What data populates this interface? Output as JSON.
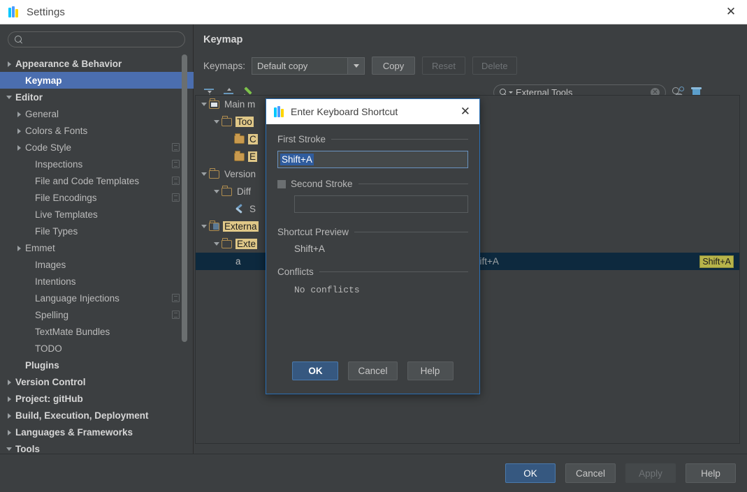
{
  "window": {
    "title": "Settings",
    "logo_icon": "webstorm-logo",
    "close_icon": "close-icon"
  },
  "sidebar": {
    "search_placeholder": "",
    "search_value": "",
    "search_icon": "search-icon",
    "items": [
      {
        "label": "Appearance & Behavior",
        "indent": 0,
        "arrow": "right",
        "bold": true,
        "selected": false,
        "copy": false
      },
      {
        "label": "Keymap",
        "indent": 1,
        "arrow": "none",
        "bold": true,
        "selected": true,
        "copy": false
      },
      {
        "label": "Editor",
        "indent": 0,
        "arrow": "down",
        "bold": true,
        "selected": false,
        "copy": false
      },
      {
        "label": "General",
        "indent": 1,
        "arrow": "right",
        "bold": false,
        "selected": false,
        "copy": false
      },
      {
        "label": "Colors & Fonts",
        "indent": 1,
        "arrow": "right",
        "bold": false,
        "selected": false,
        "copy": false
      },
      {
        "label": "Code Style",
        "indent": 1,
        "arrow": "right",
        "bold": false,
        "selected": false,
        "copy": true
      },
      {
        "label": "Inspections",
        "indent": 2,
        "arrow": "none",
        "bold": false,
        "selected": false,
        "copy": true
      },
      {
        "label": "File and Code Templates",
        "indent": 2,
        "arrow": "none",
        "bold": false,
        "selected": false,
        "copy": true
      },
      {
        "label": "File Encodings",
        "indent": 2,
        "arrow": "none",
        "bold": false,
        "selected": false,
        "copy": true
      },
      {
        "label": "Live Templates",
        "indent": 2,
        "arrow": "none",
        "bold": false,
        "selected": false,
        "copy": false
      },
      {
        "label": "File Types",
        "indent": 2,
        "arrow": "none",
        "bold": false,
        "selected": false,
        "copy": false
      },
      {
        "label": "Emmet",
        "indent": 1,
        "arrow": "right",
        "bold": false,
        "selected": false,
        "copy": false
      },
      {
        "label": "Images",
        "indent": 2,
        "arrow": "none",
        "bold": false,
        "selected": false,
        "copy": false
      },
      {
        "label": "Intentions",
        "indent": 2,
        "arrow": "none",
        "bold": false,
        "selected": false,
        "copy": false
      },
      {
        "label": "Language Injections",
        "indent": 2,
        "arrow": "none",
        "bold": false,
        "selected": false,
        "copy": true
      },
      {
        "label": "Spelling",
        "indent": 2,
        "arrow": "none",
        "bold": false,
        "selected": false,
        "copy": true
      },
      {
        "label": "TextMate Bundles",
        "indent": 2,
        "arrow": "none",
        "bold": false,
        "selected": false,
        "copy": false
      },
      {
        "label": "TODO",
        "indent": 2,
        "arrow": "none",
        "bold": false,
        "selected": false,
        "copy": false
      },
      {
        "label": "Plugins",
        "indent": 1,
        "arrow": "none",
        "bold": true,
        "selected": false,
        "copy": false
      },
      {
        "label": "Version Control",
        "indent": 0,
        "arrow": "right",
        "bold": true,
        "selected": false,
        "copy": false
      },
      {
        "label": "Project: gitHub",
        "indent": 0,
        "arrow": "right",
        "bold": true,
        "selected": false,
        "copy": false
      },
      {
        "label": "Build, Execution, Deployment",
        "indent": 0,
        "arrow": "right",
        "bold": true,
        "selected": false,
        "copy": false
      },
      {
        "label": "Languages & Frameworks",
        "indent": 0,
        "arrow": "right",
        "bold": true,
        "selected": false,
        "copy": false
      },
      {
        "label": "Tools",
        "indent": 0,
        "arrow": "down",
        "bold": true,
        "selected": false,
        "copy": false
      }
    ]
  },
  "keymap_panel": {
    "title": "Keymap",
    "keymaps_label": "Keymaps:",
    "selected_keymap": "Default copy",
    "copy_button": "Copy",
    "reset_button": "Reset",
    "delete_button": "Delete",
    "toolbar_icons": [
      "expand-all-icon",
      "collapse-all-icon",
      "edit-shortcut-icon"
    ],
    "find_value": "External Tools",
    "find_icons": [
      "search-icon",
      "chevron-down-icon",
      "clear-icon"
    ],
    "right_icons": [
      "find-by-shortcut-icon",
      "delete-shortcut-icon"
    ],
    "tree": [
      {
        "indent": 0,
        "arrow": "down",
        "icon": "menu-folder-icon",
        "label": "Main m",
        "highlight": false,
        "shortcut": ""
      },
      {
        "indent": 1,
        "arrow": "down",
        "icon": "folder-icon",
        "label": "Too",
        "highlight": true,
        "shortcut": ""
      },
      {
        "indent": 2,
        "arrow": "none",
        "icon": "folder-filled-icon",
        "label": "C",
        "highlight": true,
        "shortcut": ""
      },
      {
        "indent": 2,
        "arrow": "none",
        "icon": "folder-filled-icon",
        "label": "E",
        "highlight": true,
        "shortcut": ""
      },
      {
        "indent": 0,
        "arrow": "down",
        "icon": "folder-icon",
        "label": "Version",
        "highlight": false,
        "shortcut": ""
      },
      {
        "indent": 1,
        "arrow": "down",
        "icon": "folder-icon",
        "label": "Diff",
        "highlight": false,
        "shortcut": ""
      },
      {
        "indent": 2,
        "arrow": "none",
        "icon": "wrench-icon",
        "label": "S",
        "highlight": false,
        "shortcut": ""
      },
      {
        "indent": 0,
        "arrow": "down",
        "icon": "ext-folder-icon",
        "label": "Externa",
        "highlight": true,
        "shortcut": ""
      },
      {
        "indent": 1,
        "arrow": "down",
        "icon": "folder-icon",
        "label": "Exte",
        "highlight": true,
        "shortcut": ""
      },
      {
        "indent": 2,
        "arrow": "none",
        "icon": "none",
        "label": "a",
        "highlight": false,
        "shortcut": "Shift+A",
        "selected": true
      }
    ],
    "row_shortcut_plain": "Shift+A",
    "row_shortcut_badge": "Shift+A"
  },
  "footer": {
    "ok": "OK",
    "cancel": "Cancel",
    "apply": "Apply",
    "help": "Help"
  },
  "dialog": {
    "title": "Enter Keyboard Shortcut",
    "logo_icon": "webstorm-logo",
    "close_icon": "close-icon",
    "first_stroke_label": "First Stroke",
    "first_stroke_value": "Shift+A",
    "second_stroke_label": "Second Stroke",
    "second_stroke_checked": false,
    "second_stroke_value": "",
    "shortcut_preview_label": "Shortcut Preview",
    "shortcut_preview_value": "Shift+A",
    "conflicts_label": "Conflicts",
    "conflicts_value": "No conflicts",
    "ok": "OK",
    "cancel": "Cancel",
    "help": "Help"
  },
  "colors": {
    "background": "#3c3f41",
    "selection_blue": "#4b6eaf",
    "primary_button": "#365880",
    "highlight_yellow": "#e0c888",
    "shortcut_badge": "#b7b44a",
    "row_selected": "#0d293e"
  }
}
